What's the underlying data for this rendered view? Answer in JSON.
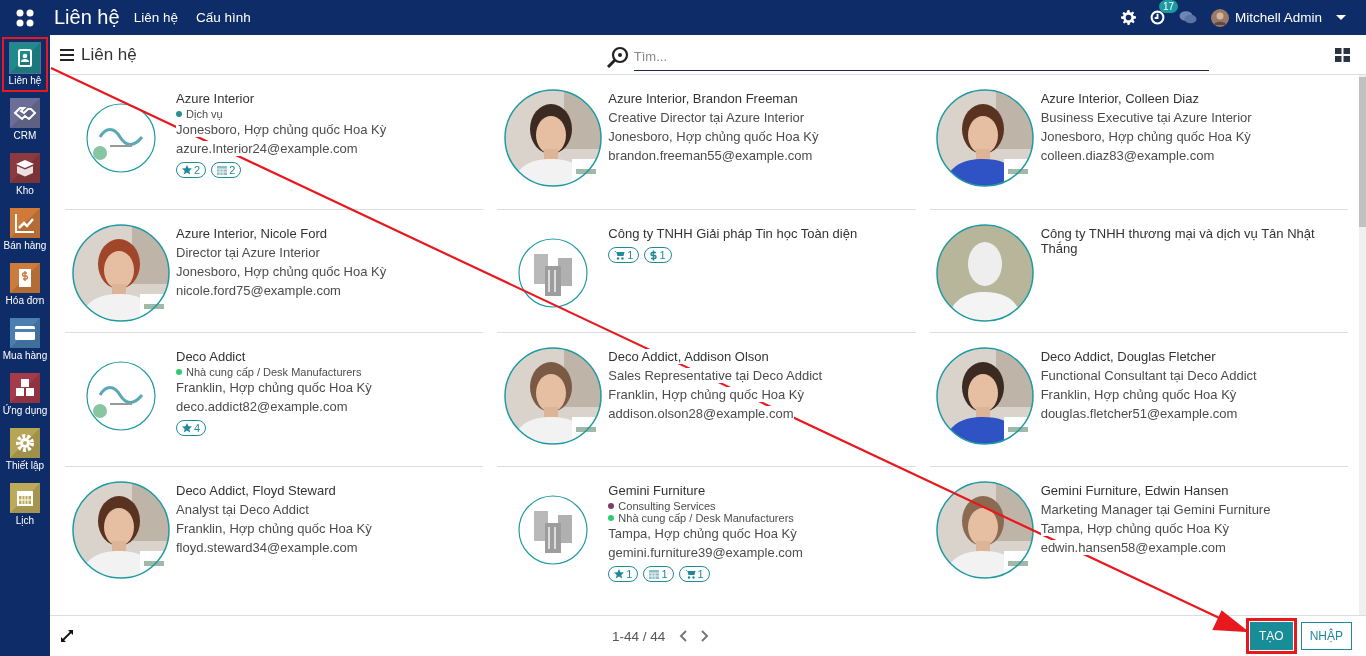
{
  "topbar": {
    "brand": "Liên hệ",
    "menu": [
      "Liên hệ",
      "Cấu hình"
    ],
    "activity_count": "17",
    "user": "Mitchell Admin"
  },
  "sidebar": {
    "items": [
      {
        "kind": "contacts",
        "label": "Liên hệ",
        "selected": true,
        "highlighted": true
      },
      {
        "kind": "crm",
        "label": "CRM",
        "selected": false,
        "highlighted": false
      },
      {
        "kind": "inventory",
        "label": "Kho",
        "selected": false,
        "highlighted": false
      },
      {
        "kind": "sales",
        "label": "Bán hàng",
        "selected": false,
        "highlighted": false
      },
      {
        "kind": "invoicing",
        "label": "Hóa đơn",
        "selected": false,
        "highlighted": false
      },
      {
        "kind": "purchase",
        "label": "Mua hàng",
        "selected": false,
        "highlighted": false
      },
      {
        "kind": "apps",
        "label": "Ứng dụng",
        "selected": false,
        "highlighted": false
      },
      {
        "kind": "settings",
        "label": "Thiết lập",
        "selected": false,
        "highlighted": false
      },
      {
        "kind": "calendar",
        "label": "Lịch",
        "selected": false,
        "highlighted": false
      }
    ]
  },
  "control_panel": {
    "breadcrumb": "Liên hệ",
    "search": {
      "placeholder": "Tìm..."
    }
  },
  "cards": [
    {
      "name": "Azure Interior",
      "tags": [
        {
          "label": "Dịch vụ",
          "color": "#2b8c9a"
        }
      ],
      "address": "Jonesboro, Hợp chủng quốc Hoa Kỳ",
      "email": "azure.Interior24@example.com",
      "badges": [
        {
          "kind": "star",
          "count": "2"
        },
        {
          "kind": "calendar",
          "count": "2"
        }
      ]
    },
    {
      "name": "Azure Interior, Brandon Freeman",
      "job": "Creative Director tại Azure Interior",
      "address": "Jonesboro, Hợp chủng quốc Hoa Kỳ",
      "email": "brandon.freeman55@example.com"
    },
    {
      "name": "Azure Interior, Colleen Diaz",
      "job": "Business Executive tại Azure Interior",
      "address": "Jonesboro, Hợp chủng quốc Hoa Kỳ",
      "email": "colleen.diaz83@example.com"
    },
    {
      "name": "Azure Interior, Nicole Ford",
      "job": "Director tại Azure Interior",
      "address": "Jonesboro, Hợp chủng quốc Hoa Kỳ",
      "email": "nicole.ford75@example.com"
    },
    {
      "name": "Công ty TNHH Giải pháp Tin học Toàn diện",
      "badges": [
        {
          "kind": "cart",
          "count": "1"
        },
        {
          "kind": "dollar",
          "count": "1"
        }
      ]
    },
    {
      "name": "Công ty TNHH thương mại và dịch vụ Tân Nhật Thắng"
    },
    {
      "name": "Deco Addict",
      "tags": [
        {
          "label": "Nhà cung cấp / Desk Manufacturers",
          "color": "#2ecc71"
        }
      ],
      "address": "Franklin, Hợp chủng quốc Hoa Kỳ",
      "email": "deco.addict82@example.com",
      "badges": [
        {
          "kind": "star",
          "count": "4"
        }
      ]
    },
    {
      "name": "Deco Addict, Addison Olson",
      "job": "Sales Representative tại Deco Addict",
      "address": "Franklin, Hợp chủng quốc Hoa Kỳ",
      "email": "addison.olson28@example.com"
    },
    {
      "name": "Deco Addict, Douglas Fletcher",
      "job": "Functional Consultant tại Deco Addict",
      "address": "Franklin, Hợp chủng quốc Hoa Kỳ",
      "email": "douglas.fletcher51@example.com"
    },
    {
      "name": "Deco Addict, Floyd Steward",
      "job": "Analyst tại Deco Addict",
      "address": "Franklin, Hợp chủng quốc Hoa Kỳ",
      "email": "floyd.steward34@example.com"
    },
    {
      "name": "Gemini Furniture",
      "tags": [
        {
          "label": "Consulting Services",
          "color": "#7a3e6a"
        },
        {
          "label": "Nhà cung cấp / Desk Manufacturers",
          "color": "#2ecc71"
        }
      ],
      "address": "Tampa, Hợp chủng quốc Hoa Kỳ",
      "email": "gemini.furniture39@example.com",
      "badges": [
        {
          "kind": "star",
          "count": "1"
        },
        {
          "kind": "calendar",
          "count": "1"
        },
        {
          "kind": "cart",
          "count": "1"
        }
      ]
    },
    {
      "name": "Gemini Furniture, Edwin Hansen",
      "job": "Marketing Manager tại Gemini Furniture",
      "address": "Tampa, Hợp chủng quốc Hoa Kỳ",
      "email": "edwin.hansen58@example.com"
    }
  ],
  "footer": {
    "pager": "1-44 / 44",
    "buttons": [
      {
        "label": "TẠO",
        "kind": "primary",
        "highlighted": true
      },
      {
        "label": "NHẬP",
        "kind": "secondary",
        "highlighted": false
      }
    ]
  }
}
